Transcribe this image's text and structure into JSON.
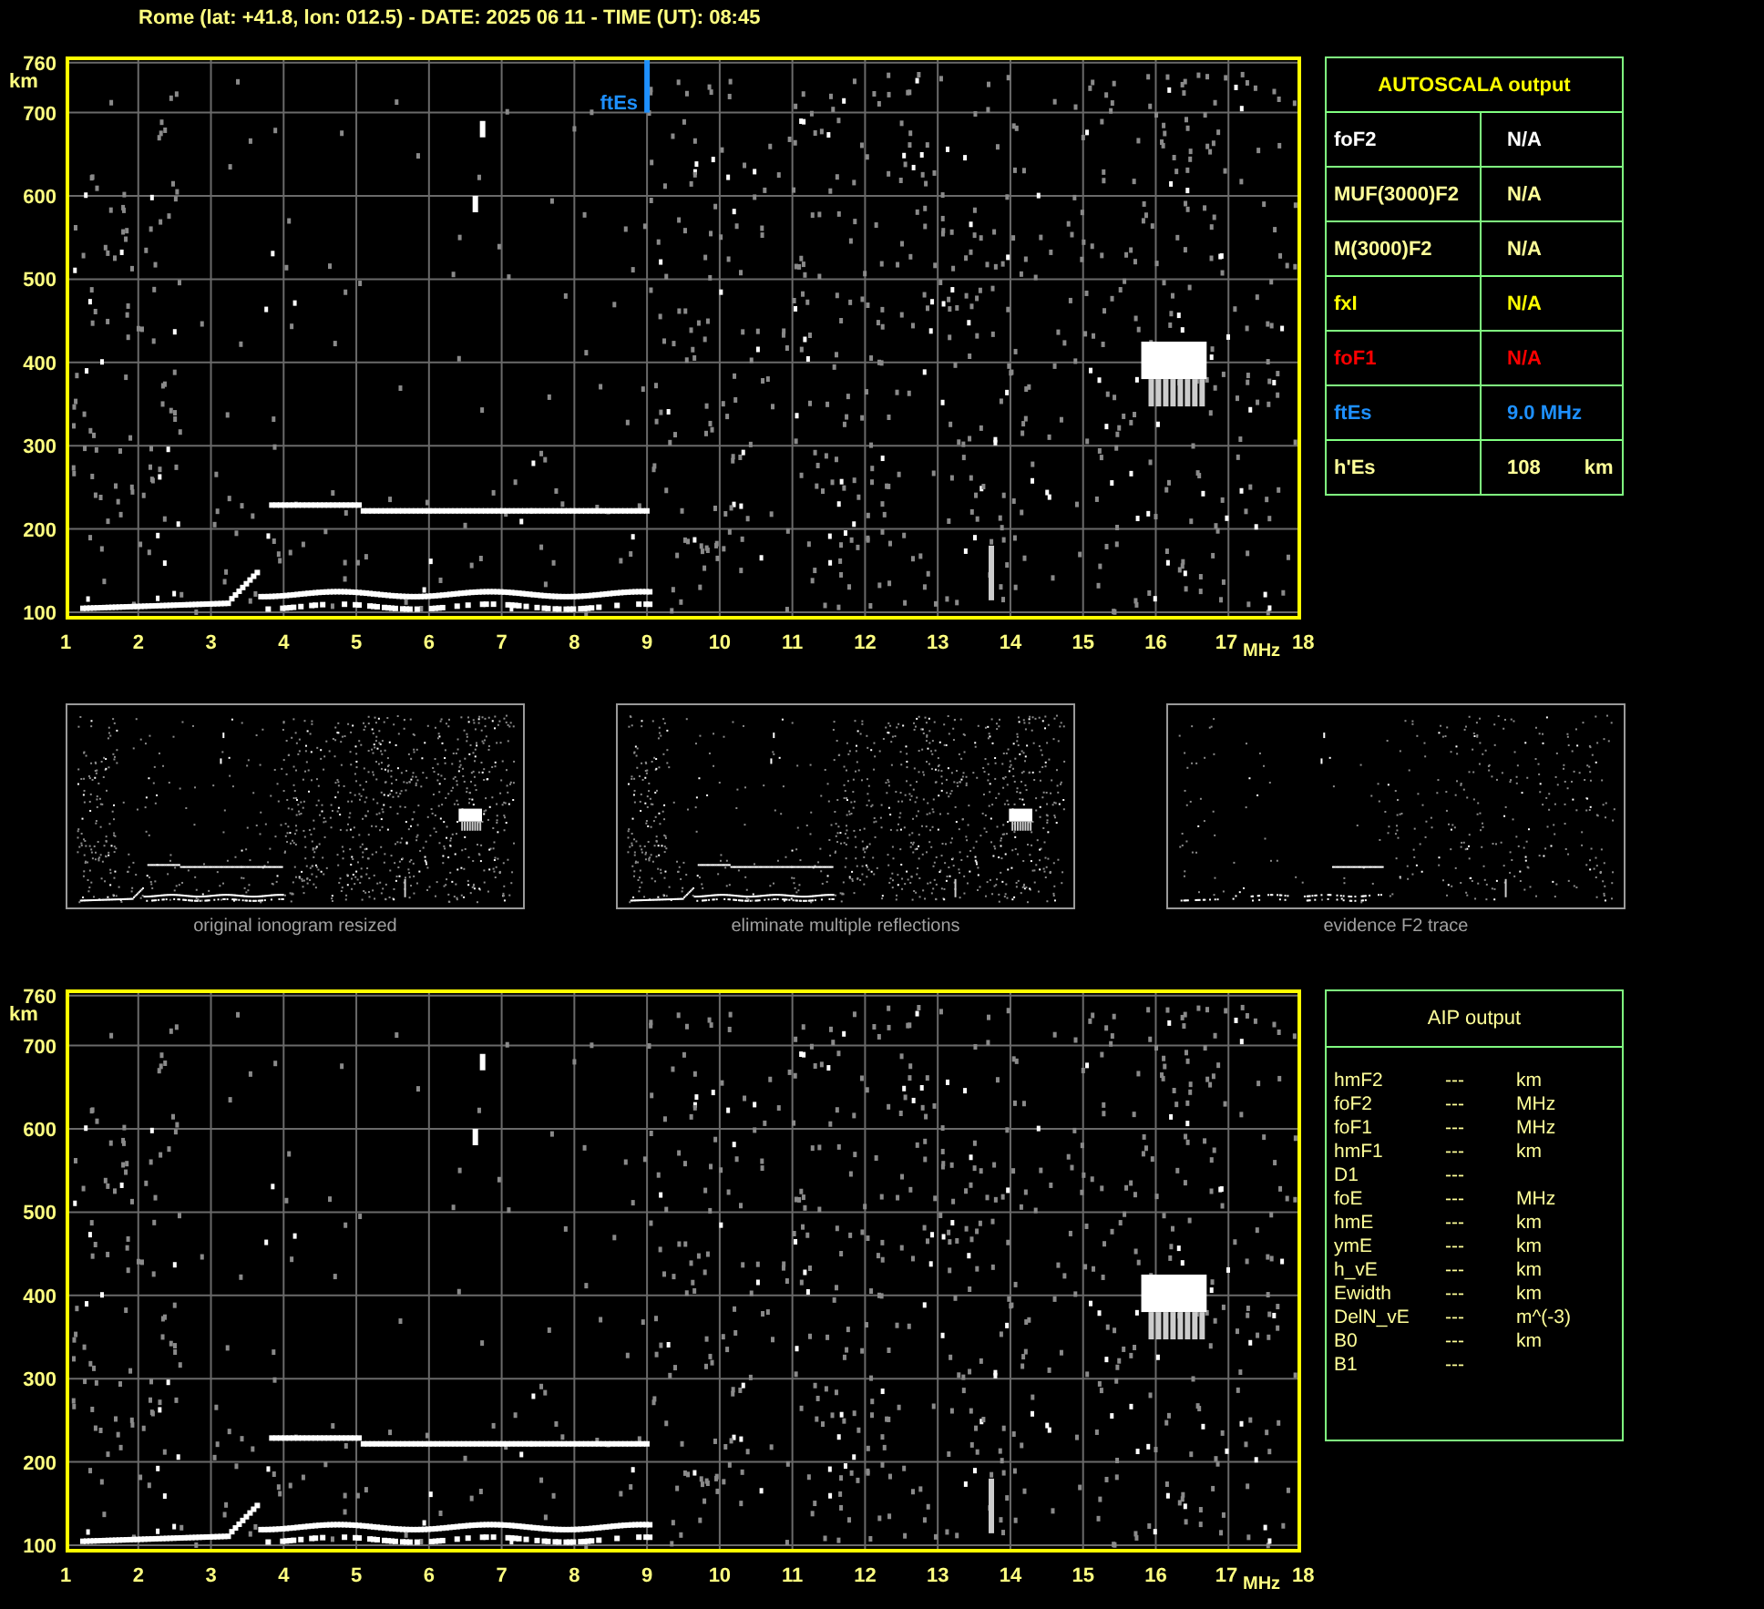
{
  "header": {
    "title": "Rome (lat: +41.8, lon: 012.5) - DATE: 2025 06 11 - TIME (UT): 08:45"
  },
  "main_plot": {
    "y_unit": "km",
    "x_unit": "MHz",
    "y_ticks": [
      "760",
      "700",
      "600",
      "500",
      "400",
      "300",
      "200",
      "100"
    ],
    "x_ticks": [
      "1",
      "2",
      "3",
      "4",
      "5",
      "6",
      "7",
      "8",
      "9",
      "10",
      "11",
      "12",
      "13",
      "14",
      "15",
      "16",
      "17",
      "18"
    ],
    "marker": {
      "label": "ftEs"
    }
  },
  "thumbnails": [
    {
      "kind": "original",
      "caption": "original ionogram resized"
    },
    {
      "kind": "eliminated",
      "caption": "eliminate multiple reflections"
    },
    {
      "kind": "evidence",
      "caption": "evidence F2 trace"
    }
  ],
  "lower_plot": {
    "y_unit": "km",
    "x_unit": "MHz",
    "y_ticks": [
      "760",
      "700",
      "600",
      "500",
      "400",
      "300",
      "200",
      "100"
    ],
    "x_ticks": [
      "1",
      "2",
      "3",
      "4",
      "5",
      "6",
      "7",
      "8",
      "9",
      "10",
      "11",
      "12",
      "13",
      "14",
      "15",
      "16",
      "17",
      "18"
    ]
  },
  "autoscala": {
    "title": "AUTOSCALA output",
    "rows": [
      {
        "name": "foF2",
        "value": "N/A",
        "color": "#ffffff"
      },
      {
        "name": "MUF(3000)F2",
        "value": "N/A",
        "color": "#ffff99"
      },
      {
        "name": "M(3000)F2",
        "value": "N/A",
        "color": "#ffff99"
      },
      {
        "name": "fxI",
        "value": "N/A",
        "color": "#ffff00"
      },
      {
        "name": "foF1",
        "value": "N/A",
        "color": "#ff0000"
      },
      {
        "name": "ftEs",
        "value": "9.0 MHz",
        "color": "#1e90ff"
      },
      {
        "name": "h'Es",
        "value": "108",
        "unit": "km",
        "color": "#ffff99"
      }
    ]
  },
  "aip": {
    "title": "AIP output",
    "rows": [
      {
        "name": "hmF2",
        "value": "---",
        "unit": "km"
      },
      {
        "name": "foF2",
        "value": "---",
        "unit": "MHz"
      },
      {
        "name": "foF1",
        "value": "---",
        "unit": "MHz"
      },
      {
        "name": "hmF1",
        "value": "---",
        "unit": "km"
      },
      {
        "name": "D1",
        "value": "---"
      },
      {
        "name": "foE",
        "value": "---",
        "unit": "MHz"
      },
      {
        "name": "hmE",
        "value": "---",
        "unit": "km"
      },
      {
        "name": "ymE",
        "value": "---",
        "unit": "km"
      },
      {
        "name": "h_vE",
        "value": "---",
        "unit": "km"
      },
      {
        "name": "Ewidth",
        "value": "---",
        "unit": "km"
      },
      {
        "name": "DelN_vE",
        "value": "---",
        "unit": "m^(-3)"
      },
      {
        "name": "B0",
        "value": "---",
        "unit": "km"
      },
      {
        "name": "B1",
        "value": "---"
      }
    ]
  }
}
